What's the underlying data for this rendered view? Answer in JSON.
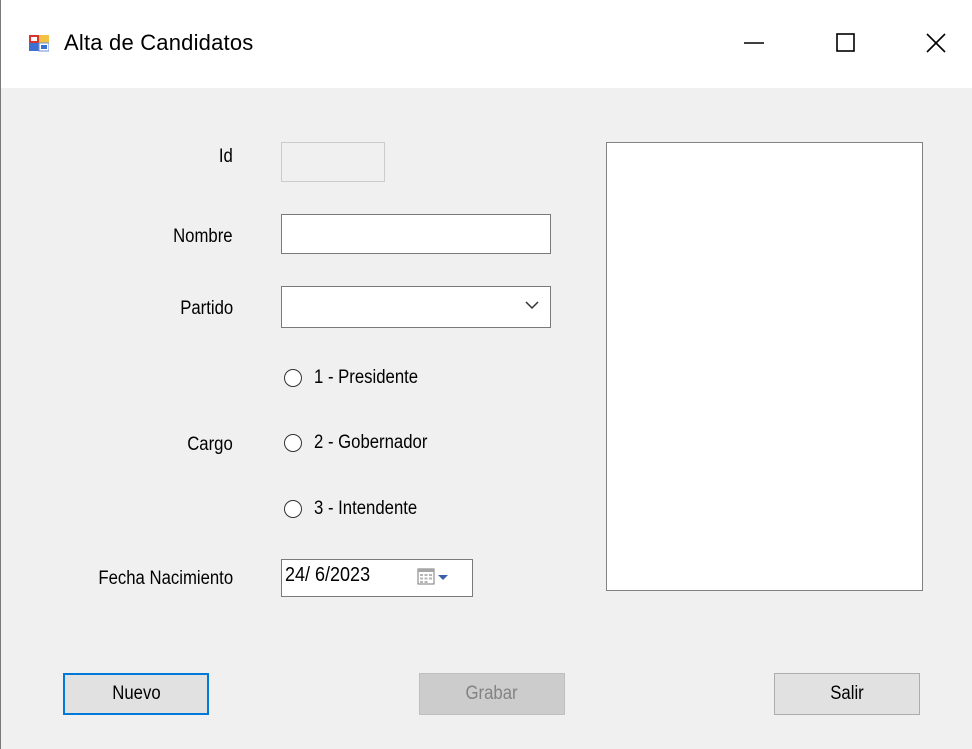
{
  "window": {
    "title": "Alta de Candidatos",
    "icon": "form-icon",
    "controls": [
      "minimize-icon",
      "maximize-icon",
      "close-icon"
    ]
  },
  "form": {
    "id_label": "Id",
    "id_value": "",
    "nombre_label": "Nombre",
    "nombre_value": "",
    "partido_label": "Partido",
    "partido_value": "",
    "cargo_label": "Cargo",
    "cargo_options": [
      {
        "label": "1 - Presidente",
        "checked": false
      },
      {
        "label": "2 - Gobernador",
        "checked": false
      },
      {
        "label": "3 - Intendente",
        "checked": false
      }
    ],
    "fecha_label": "Fecha Nacimiento",
    "fecha_value": "24/  6/2023"
  },
  "buttons": {
    "nuevo": "Nuevo",
    "grabar": "Grabar",
    "salir": "Salir"
  },
  "colors": {
    "focus_border": "#0078d7",
    "window_bg": "#f0f0f0",
    "disabled_text": "#838383"
  }
}
